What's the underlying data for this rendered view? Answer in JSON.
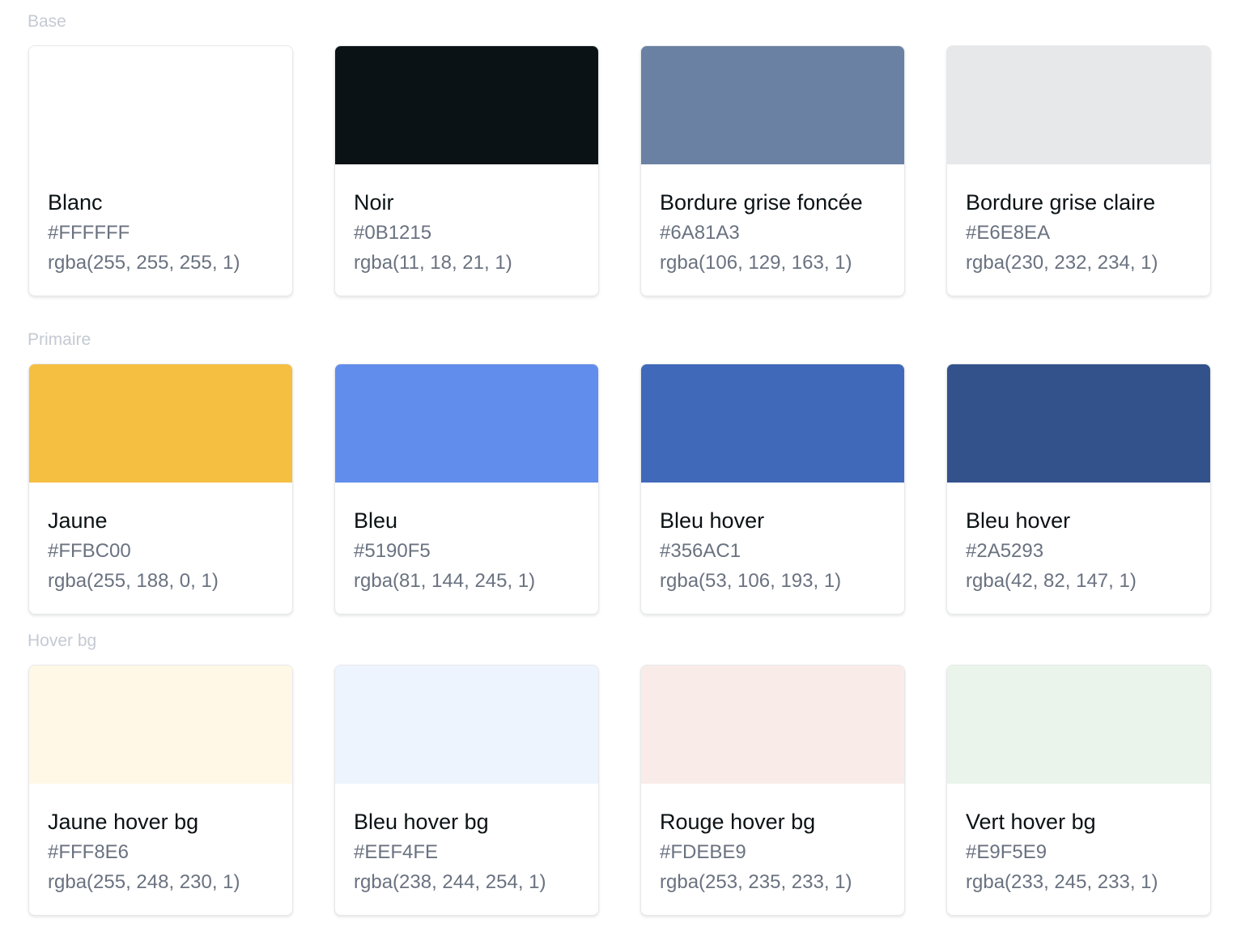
{
  "sections": [
    {
      "title": "Base",
      "colors": [
        {
          "name": "Blanc",
          "hex": "#FFFFFF",
          "rgba": "rgba(255, 255, 255, 1)",
          "swatch": "#FFFFFF"
        },
        {
          "name": "Noir",
          "hex": "#0B1215",
          "rgba": "rgba(11, 18, 21, 1)",
          "swatch": "#0B1215"
        },
        {
          "name": "Bordure grise foncée",
          "hex": "#6A81A3",
          "rgba": "rgba(106, 129, 163, 1)",
          "swatch": "#6A81A3"
        },
        {
          "name": "Bordure grise claire",
          "hex": "#E6E8EA",
          "rgba": "rgba(230, 232, 234, 1)",
          "swatch": "#E6E8EA"
        }
      ]
    },
    {
      "title": "Primaire",
      "colors": [
        {
          "name": "Jaune",
          "hex": "#FFBC00",
          "rgba": "rgba(255, 188, 0, 1)",
          "swatch": "#F5BF42"
        },
        {
          "name": "Bleu",
          "hex": "#5190F5",
          "rgba": "rgba(81, 144, 245, 1)",
          "swatch": "#618DEC"
        },
        {
          "name": "Bleu hover",
          "hex": "#356AC1",
          "rgba": "rgba(53, 106, 193, 1)",
          "swatch": "#4169BA"
        },
        {
          "name": "Bleu hover",
          "hex": "#2A5293",
          "rgba": "rgba(42, 82, 147, 1)",
          "swatch": "#33528B"
        }
      ]
    },
    {
      "title": "Hover bg",
      "colors": [
        {
          "name": "Jaune hover bg",
          "hex": "#FFF8E6",
          "rgba": "rgba(255, 248, 230, 1)",
          "swatch": "#FFF8E6"
        },
        {
          "name": "Bleu hover bg",
          "hex": "#EEF4FE",
          "rgba": "rgba(238, 244, 254, 1)",
          "swatch": "#EEF4FE"
        },
        {
          "name": "Rouge hover bg",
          "hex": "#FDEBE9",
          "rgba": "rgba(253, 235, 233, 1)",
          "swatch": "#F9ECE8"
        },
        {
          "name": "Vert hover bg",
          "hex": "#E9F5E9",
          "rgba": "rgba(233, 245, 233, 1)",
          "swatch": "#EAF4EA"
        }
      ]
    }
  ]
}
